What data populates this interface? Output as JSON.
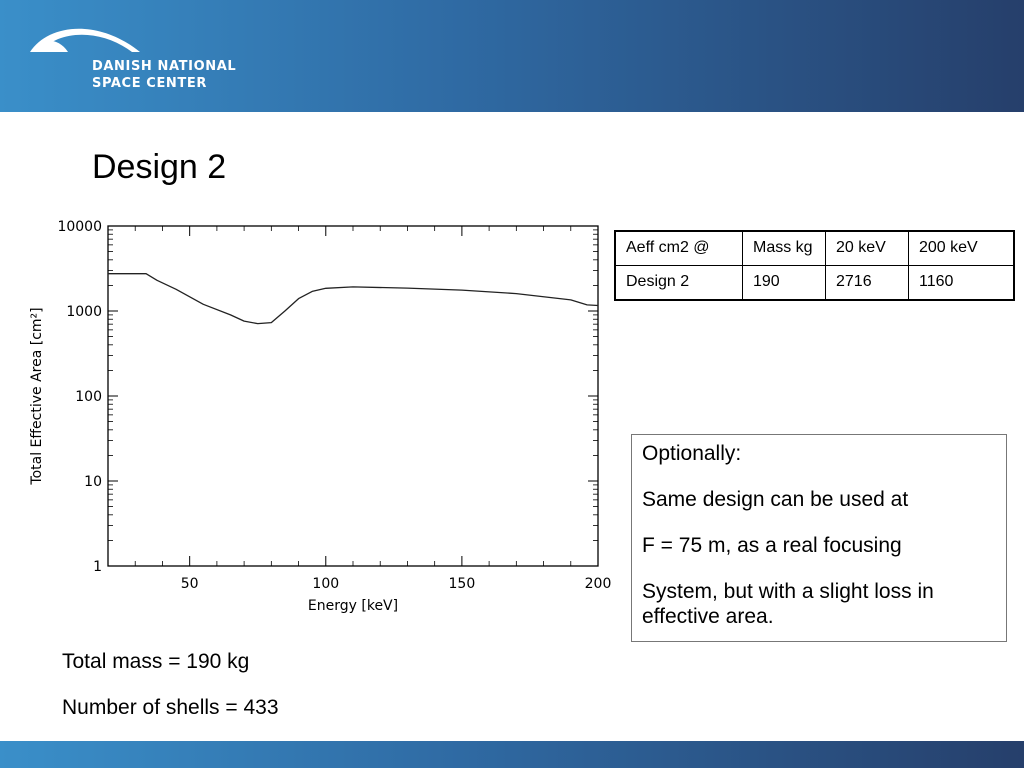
{
  "header": {
    "logo_line1": "DANISH NATIONAL",
    "logo_line2": "SPACE CENTER",
    "logo_icon": "arc-logo-icon"
  },
  "slide": {
    "title": "Design 2"
  },
  "chart_data": {
    "type": "line",
    "xlabel": "Energy [keV]",
    "ylabel": "Total Effective Area [cm²]",
    "xlim": [
      20,
      200
    ],
    "ylim": [
      1,
      10000
    ],
    "yscale": "log",
    "x_ticks": [
      50,
      100,
      150,
      200
    ],
    "y_ticks": [
      {
        "value": 1,
        "label": "1"
      },
      {
        "value": 10,
        "label": "10"
      },
      {
        "value": 100,
        "label": "100"
      },
      {
        "value": 1000,
        "label": "1000"
      },
      {
        "value": 10000,
        "label": "10000"
      }
    ],
    "series": [
      {
        "x": [
          20,
          34,
          38,
          45,
          55,
          65,
          70,
          75,
          80,
          85,
          90,
          95,
          100,
          110,
          130,
          150,
          170,
          190,
          196,
          200
        ],
        "y": [
          2750,
          2750,
          2300,
          1800,
          1200,
          900,
          760,
          710,
          730,
          1000,
          1400,
          1700,
          1850,
          1920,
          1860,
          1760,
          1600,
          1350,
          1180,
          1160
        ]
      }
    ],
    "grid": false,
    "legend": "none"
  },
  "table": {
    "headers": [
      "Aeff cm2 @",
      "Mass kg",
      "20 keV",
      "200 keV"
    ],
    "rows": [
      [
        "Design 2",
        "190",
        "2716",
        "1160"
      ]
    ]
  },
  "note": {
    "lines": [
      "Optionally:",
      "Same design can be used at",
      "F = 75 m, as a real focusing",
      "System, but with a slight loss in effective area."
    ]
  },
  "bottom": {
    "line1": "Total mass = 190 kg",
    "line2": "Number of shells = 433"
  },
  "colors": {
    "header_left": "#3a8fc9",
    "header_right": "#263f6b"
  }
}
